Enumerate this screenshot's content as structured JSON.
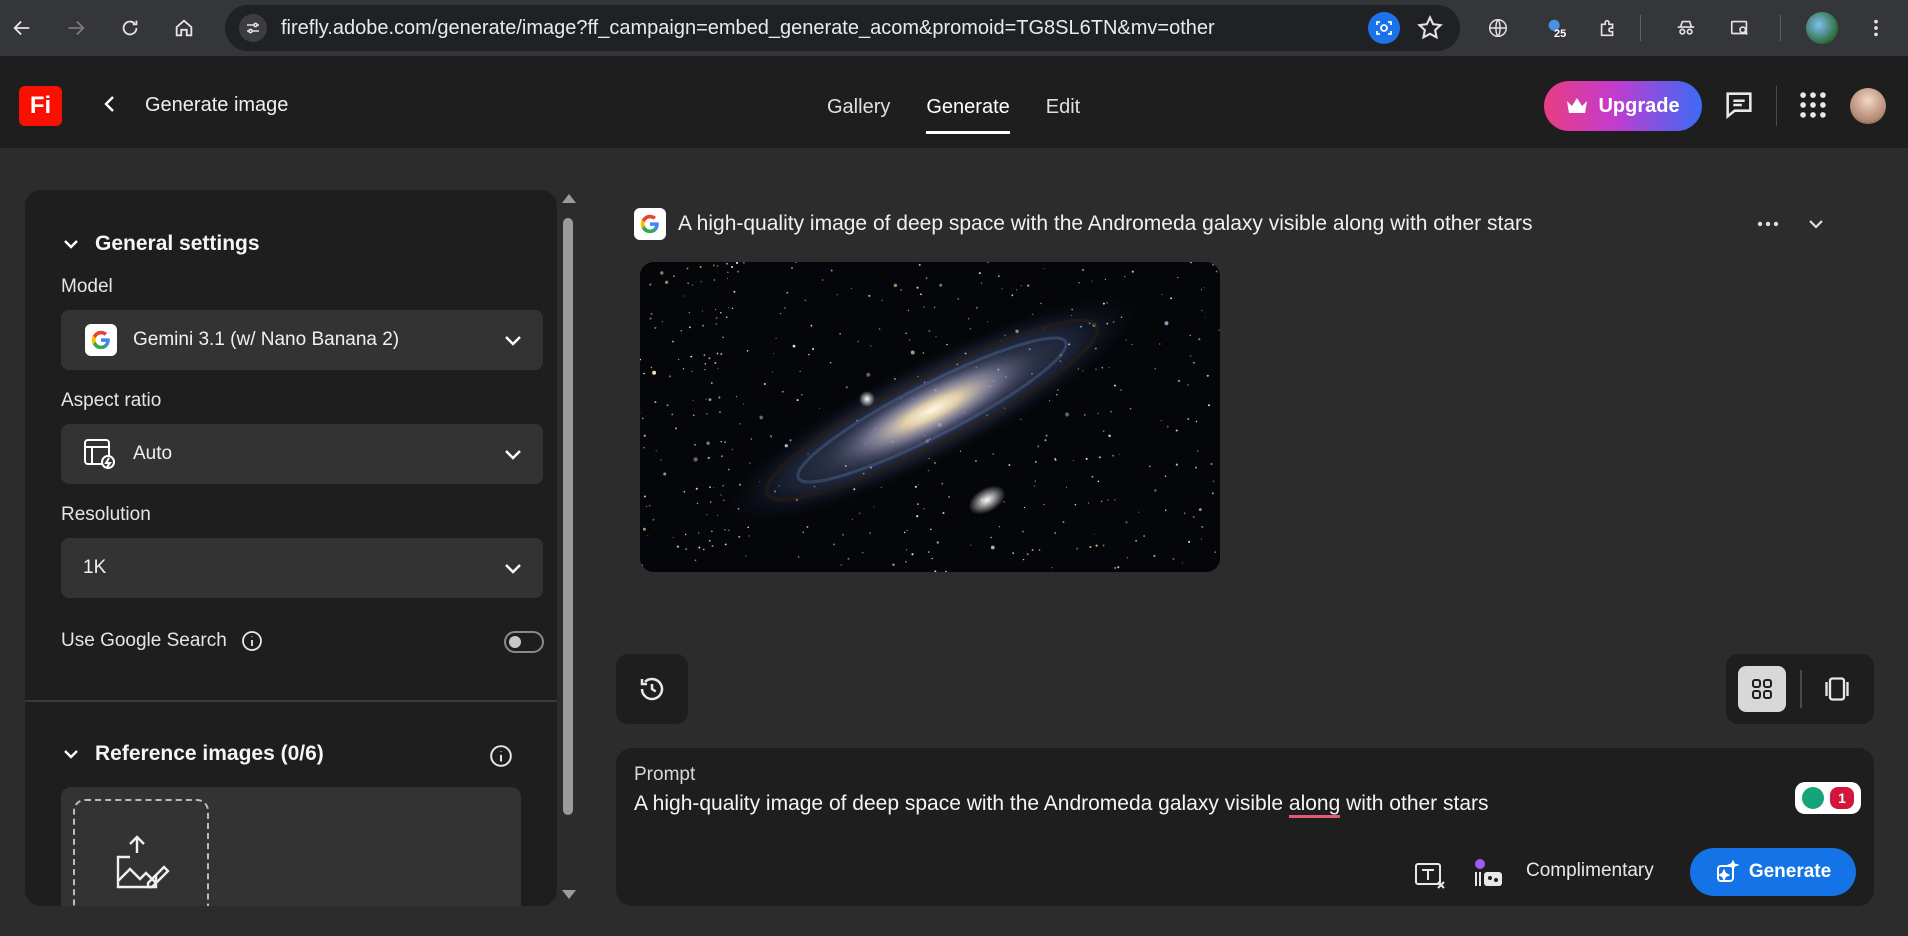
{
  "browser": {
    "url": "firefly.adobe.com/generate/image?ff_campaign=embed_generate_acom&promoid=TG8SL6TN&mv=other",
    "extension_badge": "25"
  },
  "header": {
    "logo": "Fi",
    "title": "Generate image",
    "tabs": [
      "Gallery",
      "Generate",
      "Edit"
    ],
    "active_tab": "Generate",
    "upgrade_label": "Upgrade"
  },
  "settings": {
    "general_title": "General settings",
    "model_label": "Model",
    "model_value": "Gemini 3.1 (w/ Nano Banana 2)",
    "aspect_label": "Aspect ratio",
    "aspect_value": "Auto",
    "resolution_label": "Resolution",
    "resolution_value": "1K",
    "google_search_label": "Use Google Search",
    "google_search_on": false,
    "reference_title": "Reference images (0/6)"
  },
  "result": {
    "prompt": "A high-quality image of deep space with the Andromeda galaxy visible along with other stars"
  },
  "prompt_box": {
    "label": "Prompt",
    "text_before": "A high-quality image of deep space with the Andromeda galaxy visible ",
    "text_flagged": "along",
    "text_after": " with other stars",
    "grammarly_count": "1",
    "credits_label": "Complimentary",
    "generate_label": "Generate"
  },
  "colors": {
    "accent_blue": "#1473e6",
    "adobe_red": "#fa0f00",
    "panel_bg": "#1e1e1e",
    "page_bg": "#2c2c2c"
  }
}
